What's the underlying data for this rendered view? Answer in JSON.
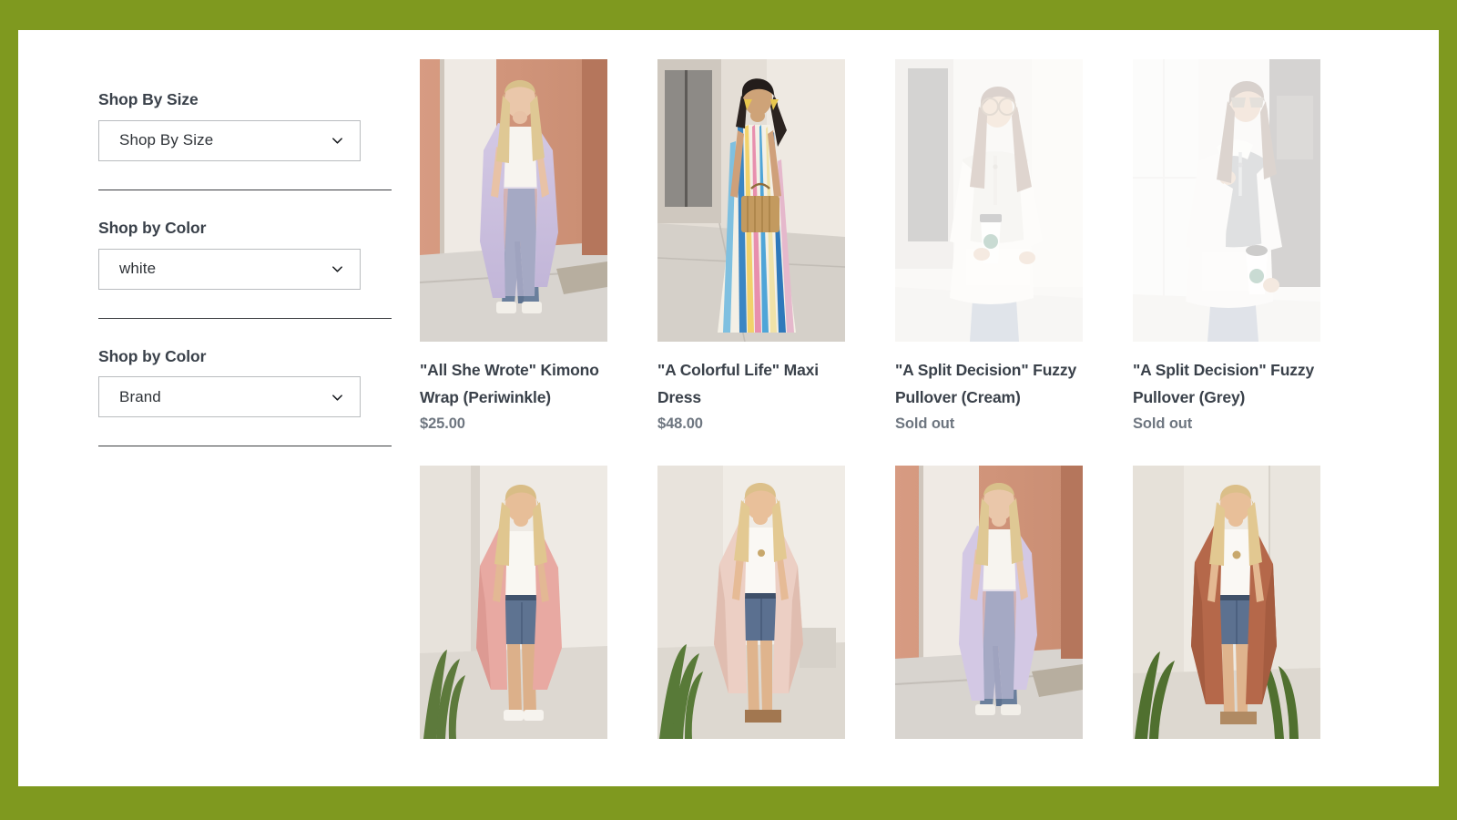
{
  "theme": {
    "page_border_color": "#7f991f",
    "page_background": "#ffffff",
    "title_color": "#3a414a",
    "price_color": "#6e7680",
    "divider_color": "#3d3f42",
    "select_border_color": "#b9bcbf"
  },
  "filters": [
    {
      "label": "Shop By Size",
      "selected": "Shop By Size",
      "icon": "chevron-down-icon"
    },
    {
      "label": "Shop by Color",
      "selected": "white",
      "icon": "chevron-down-icon"
    },
    {
      "label": "Shop by Color",
      "selected": "Brand",
      "icon": "chevron-down-icon"
    }
  ],
  "products": [
    {
      "title": "\"All She Wrote\" Kimono Wrap (Periwinkle)",
      "price": "$25.00",
      "sold_out": false,
      "image": "model-lavender-kimono-jeans"
    },
    {
      "title": "\"A Colorful Life\" Maxi Dress",
      "price": "$48.00",
      "sold_out": false,
      "image": "model-striped-maxi-dress-rattan-bag"
    },
    {
      "title": "\"A Split Decision\" Fuzzy Pullover (Cream)",
      "price": "Sold out",
      "sold_out": true,
      "image": "model-cream-fuzzy-pullover-coffee"
    },
    {
      "title": "\"A Split Decision\" Fuzzy Pullover (Grey)",
      "price": "Sold out",
      "sold_out": true,
      "image": "model-grey-fuzzy-pullover-coffee"
    },
    {
      "title": "",
      "price": "",
      "sold_out": false,
      "image": "model-pink-kimono-denim-shorts"
    },
    {
      "title": "",
      "price": "",
      "sold_out": false,
      "image": "model-blush-kimono-denim-shorts"
    },
    {
      "title": "",
      "price": "",
      "sold_out": false,
      "image": "model-lavender-kimono-jeans-2"
    },
    {
      "title": "",
      "price": "",
      "sold_out": false,
      "image": "model-rust-kimono-denim-shorts"
    }
  ]
}
